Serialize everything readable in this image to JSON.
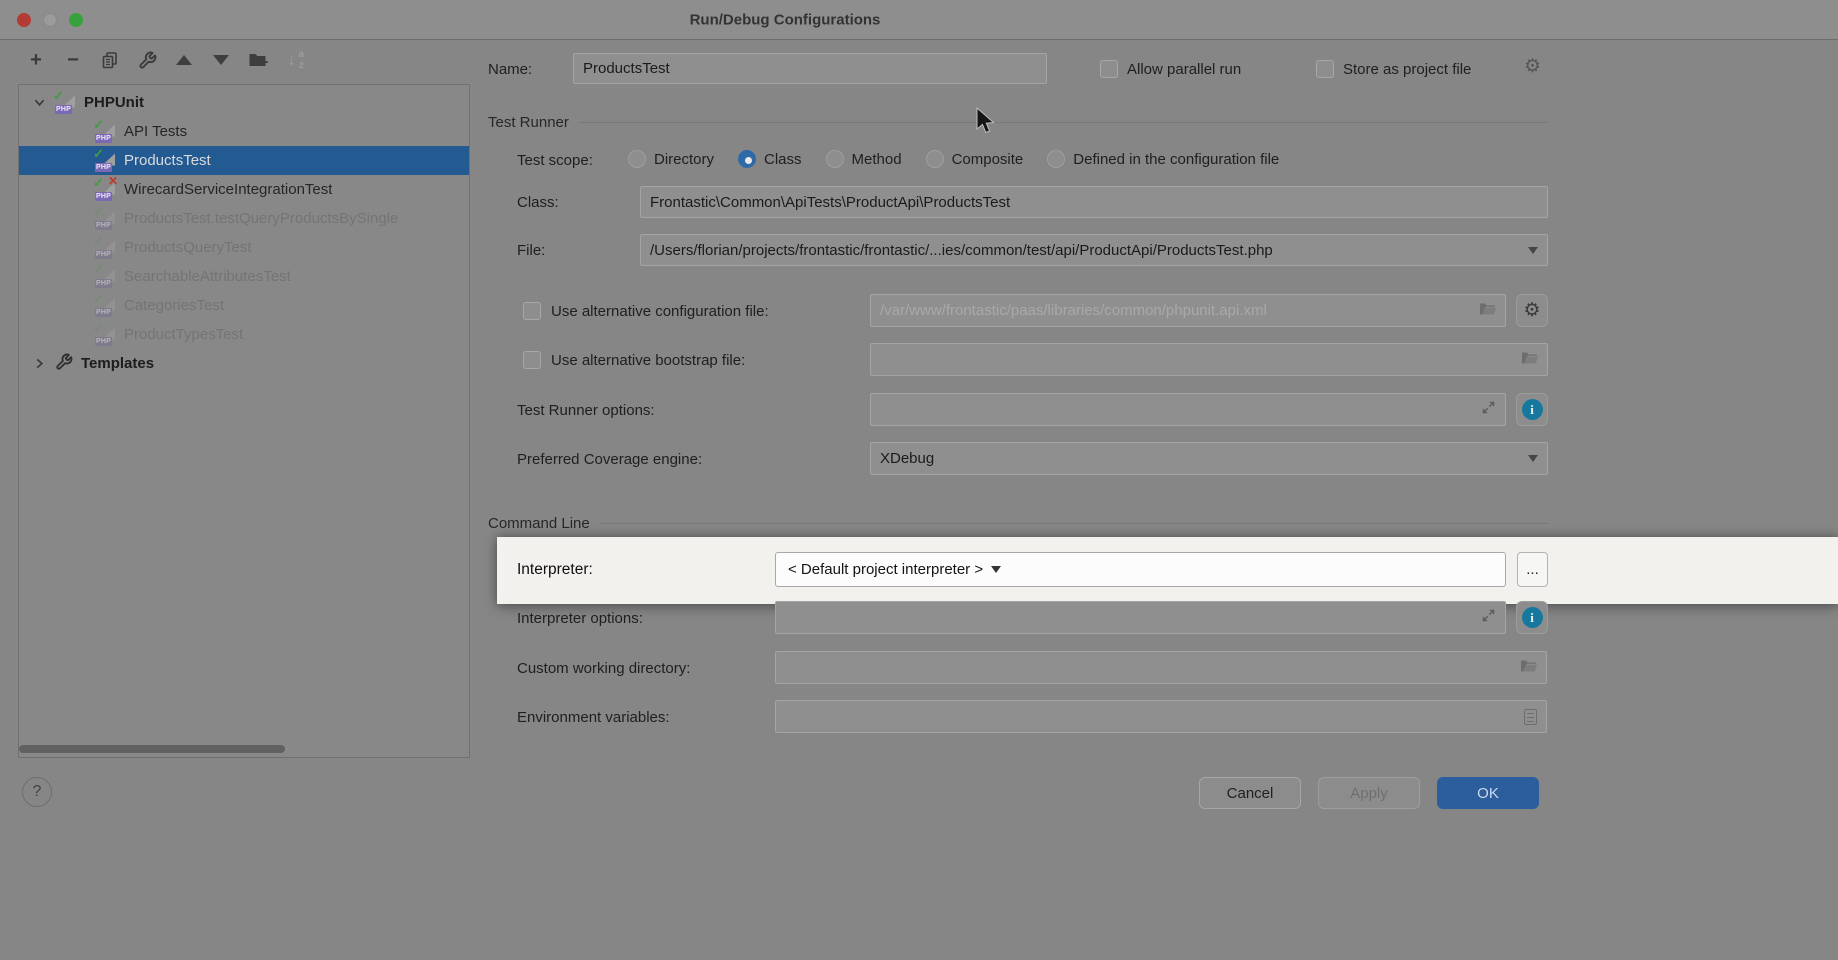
{
  "window": {
    "title": "Run/Debug Configurations"
  },
  "toolbar": {
    "icons": [
      "add-icon",
      "remove-icon",
      "copy-icon",
      "edit-defaults-wrench-icon",
      "move-up-icon",
      "move-down-icon",
      "new-folder-icon",
      "sort-alphabetically-icon"
    ]
  },
  "tree": {
    "items": [
      {
        "label": "PHPUnit",
        "kind": "group",
        "icon": "phpunit-icon",
        "state": "normal",
        "expanded": true
      },
      {
        "label": "API Tests",
        "kind": "child",
        "icon": "phpunit-icon",
        "state": "normal"
      },
      {
        "label": "ProductsTest",
        "kind": "child",
        "icon": "phpunit-icon",
        "state": "selected"
      },
      {
        "label": "WirecardServiceIntegrationTest",
        "kind": "child",
        "icon": "phpunit-failed-icon",
        "state": "normal"
      },
      {
        "label": "ProductsTest.testQueryProductsBySingle",
        "kind": "child",
        "icon": "phpunit-icon",
        "state": "muted"
      },
      {
        "label": "ProductsQueryTest",
        "kind": "child",
        "icon": "phpunit-icon",
        "state": "muted"
      },
      {
        "label": "SearchableAttributesTest",
        "kind": "child",
        "icon": "phpunit-icon",
        "state": "muted"
      },
      {
        "label": "CategoriesTest",
        "kind": "child",
        "icon": "phpunit-icon",
        "state": "muted"
      },
      {
        "label": "ProductTypesTest",
        "kind": "child",
        "icon": "phpunit-icon",
        "state": "muted"
      },
      {
        "label": "Templates",
        "kind": "group",
        "icon": "wrench-icon",
        "state": "normal",
        "expanded": false
      }
    ]
  },
  "form": {
    "name": {
      "label": "Name:",
      "value": "ProductsTest"
    },
    "allow_parallel_run_label": "Allow parallel run",
    "store_as_project_file_label": "Store as project file",
    "test_runner_section": "Test Runner",
    "test_scope": {
      "label": "Test scope:",
      "options": [
        "Directory",
        "Class",
        "Method",
        "Composite",
        "Defined in the configuration file"
      ],
      "selected": "Class"
    },
    "class_field": {
      "label": "Class:",
      "value": "Frontastic\\Common\\ApiTests\\ProductApi\\ProductsTest"
    },
    "file_field": {
      "label": "File:",
      "value": "/Users/florian/projects/frontastic/frontastic/...ies/common/test/api/ProductApi/ProductsTest.php"
    },
    "alt_config": {
      "label": "Use alternative configuration file:",
      "checked": false,
      "placeholder": "/var/www/frontastic/paas/libraries/common/phpunit.api.xml"
    },
    "alt_bootstrap": {
      "label": "Use alternative bootstrap file:",
      "checked": false,
      "value": ""
    },
    "runner_options": {
      "label": "Test Runner options:",
      "value": ""
    },
    "coverage_engine": {
      "label": "Preferred Coverage engine:",
      "value": "XDebug"
    },
    "command_line_section": "Command Line",
    "interpreter": {
      "label": "Interpreter:",
      "value": "< Default project interpreter >",
      "browse": "..."
    },
    "interpreter_options": {
      "label": "Interpreter options:",
      "value": ""
    },
    "working_directory": {
      "label": "Custom working directory:",
      "value": ""
    },
    "environment_variables": {
      "label": "Environment variables:",
      "value": ""
    }
  },
  "footer": {
    "help": "?",
    "cancel": "Cancel",
    "apply": "Apply",
    "ok": "OK"
  },
  "colors": {
    "selection": "#235a92",
    "radio_accent": "#2d6aa8",
    "ok_button": "#2c5e9d",
    "info_icon": "#17789e",
    "highlight_band": "#f2f1ee"
  }
}
